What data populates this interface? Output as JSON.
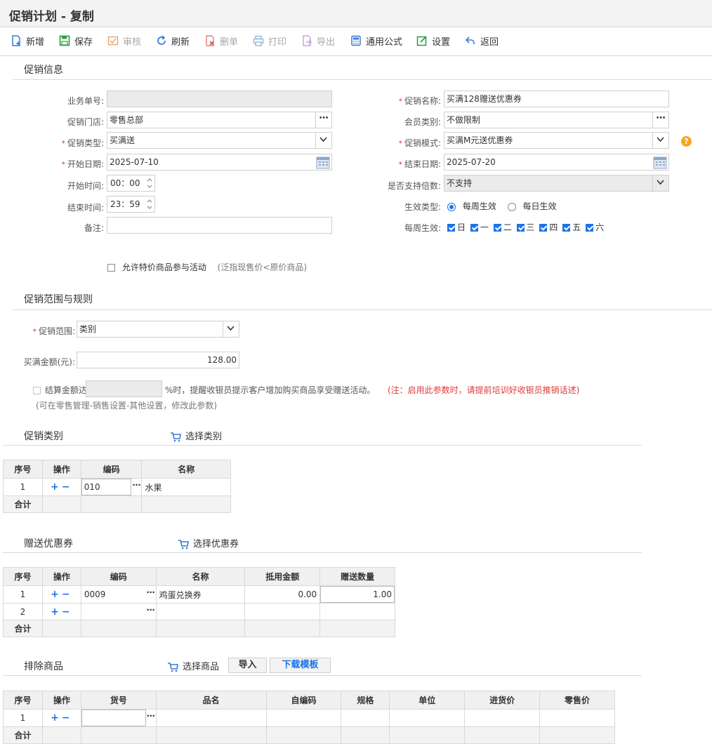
{
  "title": "促销计划 - 复制",
  "toolbar": [
    {
      "label": "新增",
      "icon": "add-doc-icon"
    },
    {
      "label": "保存",
      "icon": "save-icon"
    },
    {
      "label": "审核",
      "icon": "audit-icon"
    },
    {
      "label": "刷新",
      "icon": "refresh-icon"
    },
    {
      "label": "删单",
      "icon": "delete-doc-icon"
    },
    {
      "label": "打印",
      "icon": "print-icon"
    },
    {
      "label": "导出",
      "icon": "export-icon"
    },
    {
      "label": "通用公式",
      "icon": "formula-icon"
    },
    {
      "label": "设置",
      "icon": "settings-icon"
    },
    {
      "label": "返回",
      "icon": "back-icon"
    }
  ],
  "info": {
    "section": "促销信息",
    "order_no_label": "业务单号:",
    "order_no": "",
    "store_label": "促销门店:",
    "store": "零售总部",
    "type_label": "促销类型:",
    "type": "买满送",
    "start_date_label": "开始日期:",
    "start_date": "2025-07-10",
    "start_time_label": "开始时间:",
    "start_time": "00：00",
    "end_time_label": "结束时间:",
    "end_time": "23：59",
    "remark_label": "备注:",
    "remark": "",
    "name_label": "促销名称:",
    "name": "买满128赠送优惠券",
    "member_label": "会员类别:",
    "member": "不做限制",
    "mode_label": "促销模式:",
    "mode": "买满M元送优惠券",
    "end_date_label": "结束日期:",
    "end_date": "2025-07-20",
    "multiple_label": "是否支持倍数:",
    "multiple": "不支持",
    "effect_type_label": "生效类型:",
    "effect_weekly": "每周生效",
    "effect_daily": "每日生效",
    "weekly_label": "每周生效:",
    "weekdays": [
      "日",
      "一",
      "二",
      "三",
      "四",
      "五",
      "六"
    ],
    "allow_special_label": "允许特价商品参与活动",
    "allow_special_note": "(泛指现售价<原价商品)",
    "help": "?"
  },
  "rules": {
    "section": "促销范围与规则",
    "range_label": "促销范围:",
    "range": "类别",
    "amount_label": "买满金额(元):",
    "amount": "128.00",
    "settle_label": "结算金额达",
    "settle_value": "",
    "settle_suffix": "%时，提醒收银员提示客户增加购买商品享受赠送活动。",
    "settle_note": "(注：启用此参数时，请提前培训好收银员推销话述)",
    "settle_hint": "(可在零售管理-销售设置-其他设置，修改此参数)"
  },
  "category": {
    "section": "促销类别",
    "select_label": "选择类别",
    "headers": [
      "序号",
      "操作",
      "编码",
      "名称"
    ],
    "rows": [
      {
        "no": "1",
        "code": "010",
        "name": "水果"
      }
    ],
    "sum": "合计"
  },
  "coupon": {
    "section": "赠送优惠券",
    "select_label": "选择优惠券",
    "headers": [
      "序号",
      "操作",
      "编码",
      "名称",
      "抵用金额",
      "赠送数量"
    ],
    "rows": [
      {
        "no": "1",
        "code": "0009",
        "name": "鸡蛋兑换券",
        "amount": "0.00",
        "qty": "1.00"
      },
      {
        "no": "2",
        "code": "",
        "name": "",
        "amount": "",
        "qty": ""
      }
    ],
    "sum": "合计"
  },
  "exclude": {
    "section": "排除商品",
    "select_label": "选择商品",
    "import_label": "导入",
    "template_label": "下载模板",
    "headers": [
      "序号",
      "操作",
      "货号",
      "品名",
      "自编码",
      "规格",
      "单位",
      "进货价",
      "零售价"
    ],
    "rows": [
      {
        "no": "1"
      }
    ],
    "sum": "合计"
  },
  "colors": {
    "accent": "#1a73e8",
    "required": "#e03a3a",
    "help": "#f5a623"
  }
}
